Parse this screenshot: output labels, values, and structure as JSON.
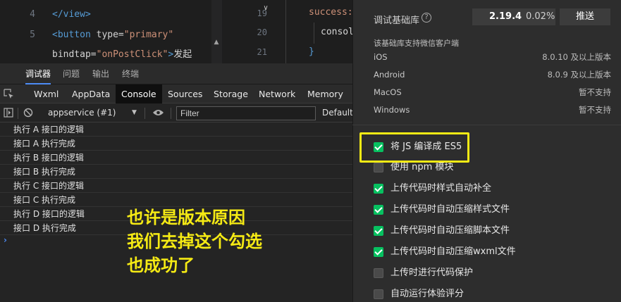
{
  "editor": {
    "lines": [
      {
        "num": "4",
        "parts": [
          {
            "t": "tag",
            "v": "</view>"
          }
        ]
      },
      {
        "num": "5",
        "parts": [
          {
            "t": "tag",
            "v": "<button "
          },
          {
            "t": "attr",
            "v": "type="
          },
          {
            "t": "str",
            "v": "\"primary\""
          }
        ]
      },
      {
        "num": "",
        "parts": [
          {
            "t": "attr",
            "v": "bindtap="
          },
          {
            "t": "str",
            "v": "\"onPostClick\""
          },
          {
            "t": "tag",
            "v": ">"
          },
          {
            "t": "txt",
            "v": "发起"
          }
        ]
      }
    ],
    "right_line_numbers": [
      "19",
      "20",
      "21"
    ],
    "right_code": [
      "success:",
      "consol",
      "}"
    ]
  },
  "devtools": {
    "tabs": [
      "调试器",
      "问题",
      "输出",
      "终端"
    ],
    "active_tab": "调试器",
    "panels": [
      "Wxml",
      "AppData",
      "Console",
      "Sources",
      "Storage",
      "Network",
      "Memory"
    ],
    "active_panel": "Console",
    "context": "appservice (#1)",
    "filter_placeholder": "Filter",
    "levels": "Default",
    "logs": [
      "执行 A 接口的逻辑",
      "接口 A 执行完成",
      "执行 B 接口的逻辑",
      "接口 B 执行完成",
      "执行 C 接口的逻辑",
      "接口 C 执行完成",
      "执行 D 接口的逻辑",
      "接口 D 执行完成"
    ],
    "prompt": "›"
  },
  "annotation": {
    "lines": [
      "也许是版本原因",
      "我们去掉这个勾选",
      "也成功了"
    ],
    "color": "#f5ea14"
  },
  "settings": {
    "lib_label": "调试基础库",
    "lib_version": "2.19.4",
    "lib_percent": "0.02%",
    "push_label": "推送",
    "support_note": "该基础库支持微信客户端",
    "os": [
      {
        "name": "iOS",
        "value": "8.0.10 及以上版本"
      },
      {
        "name": "Android",
        "value": "8.0.9 及以上版本"
      },
      {
        "name": "MacOS",
        "value": "暂不支持"
      },
      {
        "name": "Windows",
        "value": "暂不支持"
      }
    ],
    "options": [
      {
        "label": "将 JS 编译成 ES5",
        "checked": true
      },
      {
        "label": "使用 npm 模块",
        "checked": false
      },
      {
        "label": "上传代码时样式自动补全",
        "checked": true
      },
      {
        "label": "上传代码时自动压缩样式文件",
        "checked": true
      },
      {
        "label": "上传代码时自动压缩脚本文件",
        "checked": true
      },
      {
        "label": "上传代码时自动压缩wxml文件",
        "checked": true
      },
      {
        "label": "上传时进行代码保护",
        "checked": false
      },
      {
        "label": "自动运行体验评分",
        "checked": false
      }
    ],
    "accent": "#07c160"
  }
}
